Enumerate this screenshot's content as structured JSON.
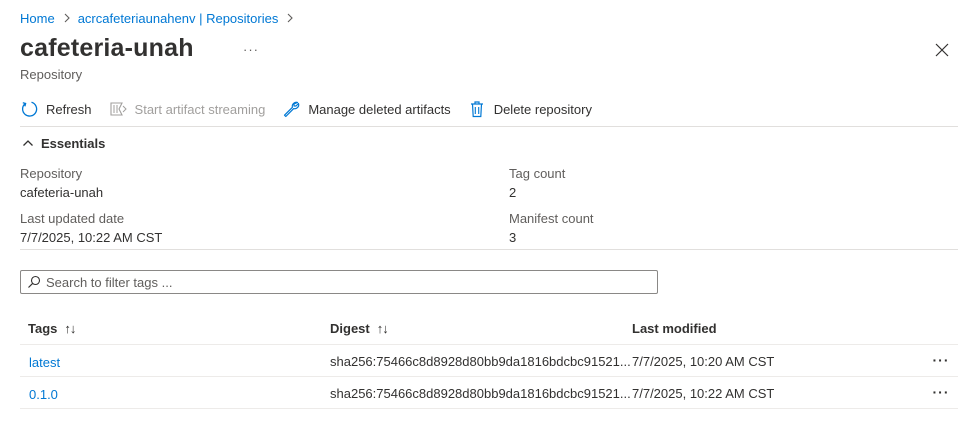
{
  "breadcrumb": {
    "items": [
      {
        "label": "Home"
      },
      {
        "label": "acrcafeteriaunahenv | Repositories"
      }
    ]
  },
  "header": {
    "title": "cafeteria-unah",
    "more": "···",
    "subtitle": "Repository",
    "close_icon": "close-icon"
  },
  "toolbar": {
    "refresh": {
      "label": "Refresh",
      "icon": "refresh-icon"
    },
    "start_streaming": {
      "label": "Start artifact streaming",
      "icon": "streaming-icon",
      "disabled": true
    },
    "manage_deleted": {
      "label": "Manage deleted artifacts",
      "icon": "wrench-icon"
    },
    "delete_repository": {
      "label": "Delete repository",
      "icon": "trash-icon"
    }
  },
  "essentials": {
    "title": "Essentials",
    "repository_label": "Repository",
    "repository_value": "cafeteria-unah",
    "last_updated_label": "Last updated date",
    "last_updated_value": "7/7/2025, 10:22 AM CST",
    "tag_count_label": "Tag count",
    "tag_count_value": "2",
    "manifest_count_label": "Manifest count",
    "manifest_count_value": "3"
  },
  "search": {
    "placeholder": "Search to filter tags ...",
    "value": ""
  },
  "table": {
    "columns": {
      "tags": "Tags",
      "digest": "Digest",
      "last_modified": "Last modified"
    },
    "sort_glyph": "↑↓",
    "rows": [
      {
        "tag": "latest",
        "digest": "sha256:75466c8d8928d80bb9da1816bdcbc91521...",
        "last_modified": "7/7/2025, 10:20 AM CST",
        "more": "···"
      },
      {
        "tag": "0.1.0",
        "digest": "sha256:75466c8d8928d80bb9da1816bdcbc91521...",
        "last_modified": "7/7/2025, 10:22 AM CST",
        "more": "···"
      }
    ]
  },
  "colors": {
    "accent": "#0078d4",
    "text": "#323130",
    "muted": "#605e5c",
    "disabled": "#a19f9d",
    "divider": "#e1dfdd"
  }
}
